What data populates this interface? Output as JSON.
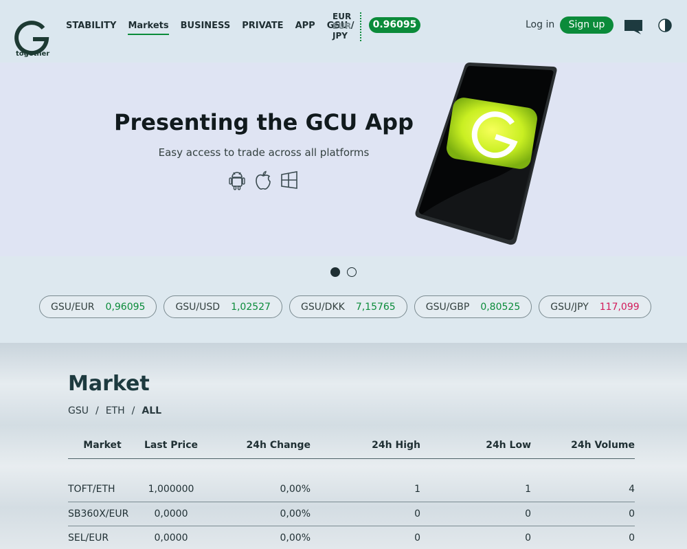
{
  "header": {
    "logo_text": "together",
    "nav": [
      "STABILITY",
      "Markets",
      "BUSINESS",
      "PRIVATE",
      "APP",
      "GSU /"
    ],
    "currencies": [
      "EUR",
      "EUR",
      "JPY"
    ],
    "rate": "0.96095",
    "login": "Log in",
    "signup": "Sign up",
    "icons": [
      "chat-icon",
      "contrast-icon"
    ]
  },
  "hero": {
    "title": "Presenting the GCU App",
    "subtitle": "Easy access to trade across all platforms",
    "platforms": [
      "android-icon",
      "apple-icon",
      "windows-icon"
    ]
  },
  "tickers": [
    {
      "pair": "GSU/EUR",
      "value": "0,96095",
      "trend": "up"
    },
    {
      "pair": "GSU/USD",
      "value": "1,02527",
      "trend": "up"
    },
    {
      "pair": "GSU/DKK",
      "value": "7,15765",
      "trend": "up"
    },
    {
      "pair": "GSU/GBP",
      "value": "0,80525",
      "trend": "up"
    },
    {
      "pair": "GSU/JPY",
      "value": "117,099",
      "trend": "down"
    }
  ],
  "market": {
    "title": "Market",
    "filters": [
      "GSU",
      "ETH",
      "ALL"
    ],
    "selected_filter": "ALL",
    "columns": [
      "Market",
      "Last Price",
      "24h Change",
      "24h High",
      "24h Low",
      "24h Volume"
    ],
    "rows": [
      [
        "TOFT/ETH",
        "1,000000",
        "0,00%",
        "1",
        "1",
        "4"
      ],
      [
        "SB360X/EUR",
        "0,0000",
        "0,00%",
        "0",
        "0",
        "0"
      ],
      [
        "SEL/EUR",
        "0,0000",
        "0,00%",
        "0",
        "0",
        "0"
      ]
    ]
  },
  "colors": {
    "accent": "#0b8b3a",
    "negative": "#d21b5a"
  }
}
